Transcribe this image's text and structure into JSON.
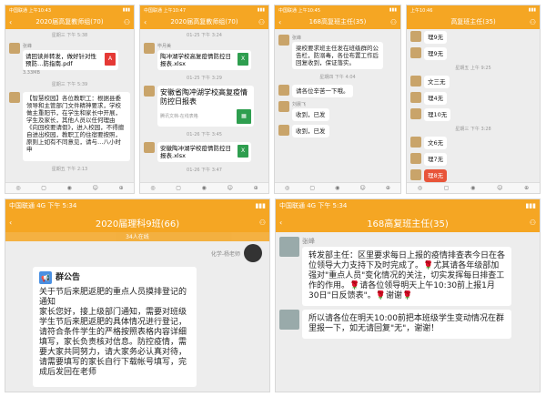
{
  "p1": {
    "status": "中国联通 上午10:43",
    "title": "2020届高复教师组(70)",
    "ts1": "星期三 下午 5:38",
    "name1": "张峰",
    "msg1": "请回读并转发，做好针对性预防…防指南.pdf",
    "size": "3.33MB",
    "ts2": "星期三 下午 5:39",
    "msg2": "【智慧校园】各位教职工：根据县委领导和主管部门文件精神要求，学校做主重阳节，在学生和家长中开展，学生及家长，其他人员以任何理由《向回校要请假》，进入校园，不得擅自进出校园，教职工的住宿要按照，原则上如有不同意见，请与…八小时申",
    "ts3": "星期五 下午 2:13"
  },
  "p2": {
    "status": "中国联通 上午10:47",
    "title": "2020届高复教师组(70)",
    "ts1": "01-25 下午 3:24",
    "name1": "毕月美",
    "msg1": "陶冲湖学校高复疫情防控日报表.xlsx",
    "ts2": "01-25 下午 3:29",
    "msg2": "安徽省陶冲湖学校高复疫情防控日报表",
    "sub2": "腾讯文档-在线表格",
    "ts3": "01-26 下午 3:45",
    "msg3": "安徽陶冲湖学校疫情防控日报表.xlsx",
    "ts4": "01-26 下午 3:47"
  },
  "p3": {
    "status": "中国联通 上午10:45",
    "title": "168高复班主任(35)",
    "name1": "张峰",
    "msg1": "梁校要求班主任发在班级群的公告栏，防溺毒，各位布置工作后回复收到，保证落实。",
    "ts1": "星期四 下午 4:04",
    "msg2": "请各位辛苦一下哦。",
    "name3": "刘晨飞",
    "msg3": "收到，已发",
    "msg4": "收到，已发"
  },
  "p4": {
    "status": "上午10:46",
    "title": "高复班主任(35)",
    "m1": "理9无",
    "m2": "理9无",
    "ts1": "星期五 上午 9:25",
    "m3": "文三无",
    "m4": "理4无",
    "m5": "理10无",
    "ts2": "星期三 下午 3:28",
    "m6": "文6无",
    "m7": "理7无",
    "m8": "理8无"
  },
  "p5": {
    "status": "中国联通 4G 下午 5:34",
    "title": "2020届理科9班(66)",
    "subtitle": "34人在线",
    "hint": "化学-杨老师",
    "notice": "群公告",
    "msg": "关于节后来肥返肥的重点人员摸排登记的通知\n家长您好，接上级部门通知，需要对班级学生节后来肥返肥的具体情况进行登记，请符合条件学生的严格按照表格内容详细填写，家长负责核对信息。防控疫情，需要大家共同努力，请大家务必认真对待，请需要填写的家长自行下载帐号填写，完成后发回在老师"
  },
  "p6": {
    "status": "中国联通 4G 下午 5:34",
    "title": "168高复班主任(35)",
    "name": "张峰",
    "msg1": "转发部主任：区里要求每日上报的疫情排查表今日在各位领导大力支持下及时完成了。🌹尤其请各年级部加强对\"重点人员\"变化情况的关注，切实发挥每日排查工作的作用。🌹请各位领导明天上午10:30前上报1月30日\"日反馈表\"。🌹谢谢🌹",
    "msg2": "所以请各位在明天10:00前把本班级学生变动情况在群里报一下，如无请回复\"无\"，谢谢！"
  },
  "colors": {
    "accent": "#f5a623",
    "pdf": "#e53935",
    "xls": "#2e9e4f"
  },
  "icons": {
    "back": "back-arrow-icon",
    "more": "person-icon"
  }
}
